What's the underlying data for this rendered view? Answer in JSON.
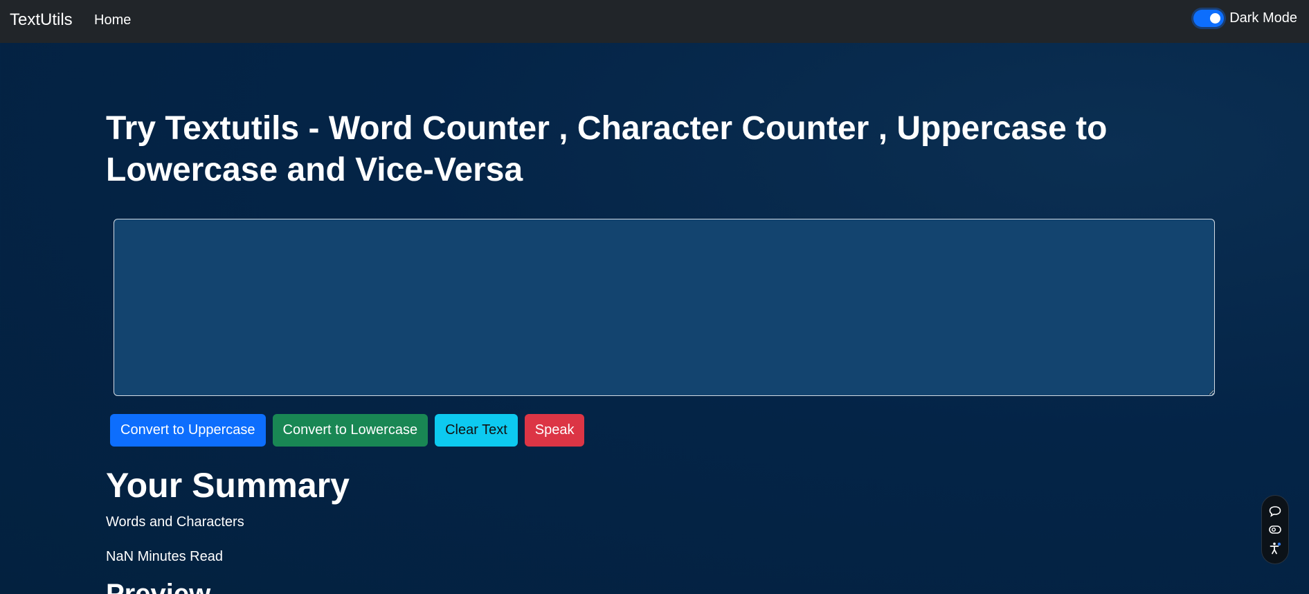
{
  "navbar": {
    "brand": "TextUtils",
    "links": [
      "Home"
    ],
    "dark_mode_label": "Dark Mode",
    "dark_mode_enabled": true
  },
  "main": {
    "title": "Try Textutils - Word Counter , Character Counter , Uppercase to Lowercase and Vice-Versa",
    "textarea_value": "",
    "buttons": {
      "uppercase": "Convert to Uppercase",
      "lowercase": "Convert to Lowercase",
      "clear": "Clear Text",
      "speak": "Speak"
    }
  },
  "summary": {
    "title": "Your Summary",
    "words_chars": "Words and Characters",
    "read_time": "NaN Minutes Read",
    "preview_title": "Preview"
  },
  "floating_toolbar": {
    "icons": [
      "chat-icon",
      "eye-icon",
      "accessibility-icon"
    ]
  },
  "colors": {
    "navbar_bg": "#212529",
    "page_bg": "#042447",
    "textarea_bg": "#13446f",
    "primary": "#0d6efd",
    "success": "#198754",
    "info": "#0dcaf0",
    "danger": "#dc3545"
  }
}
